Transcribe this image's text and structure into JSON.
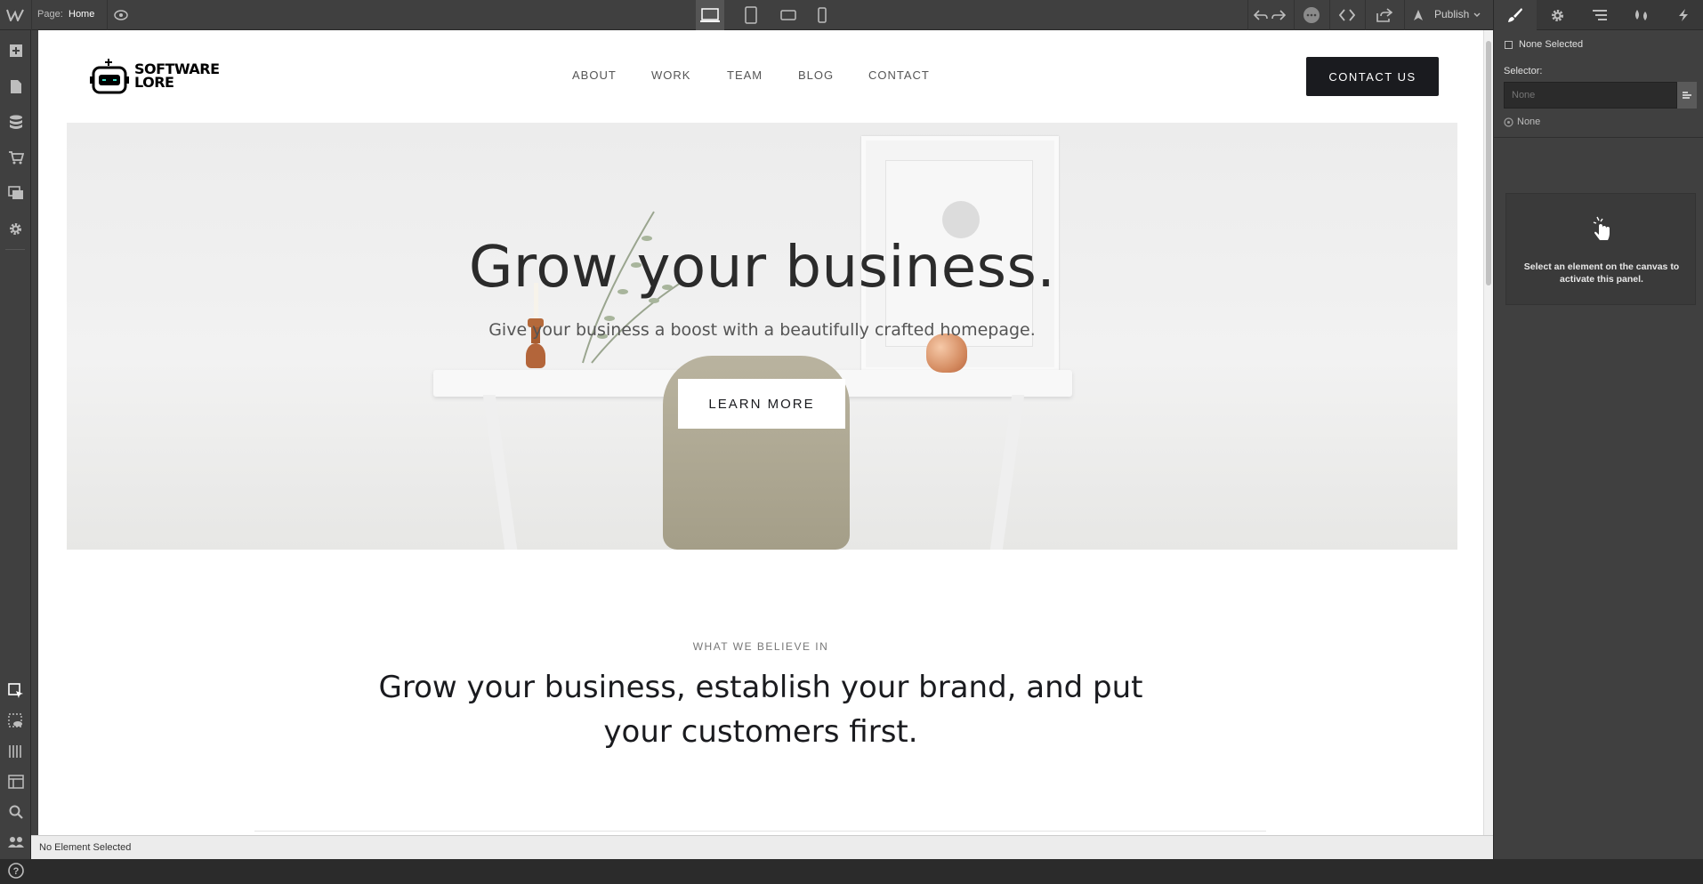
{
  "editor": {
    "page_label": "Page:",
    "page_name": "Home",
    "publish_label": "Publish",
    "status_text": "No Element Selected"
  },
  "right_panel": {
    "none_selected": "None Selected",
    "selector_label": "Selector:",
    "selector_placeholder": "None",
    "state_label": "None",
    "empty_message": "Select an element on the canvas to activate this panel."
  },
  "site": {
    "logo_line1": "SOFTWARE",
    "logo_line2": "LORE",
    "nav": [
      "ABOUT",
      "WORK",
      "TEAM",
      "BLOG",
      "CONTACT"
    ],
    "contact_button": "CONTACT US",
    "hero_title": "Grow your business.",
    "hero_subtitle": "Give your business a boost with a beautifully crafted homepage.",
    "hero_button": "LEARN MORE",
    "section_eyebrow": "WHAT WE BELIEVE IN",
    "section_heading": "Grow your business, establish your brand, and put your customers first."
  },
  "colors": {
    "editor_bg": "#404040",
    "accent_dark": "#1a1b1f",
    "text_dark": "#1a1b1f"
  }
}
